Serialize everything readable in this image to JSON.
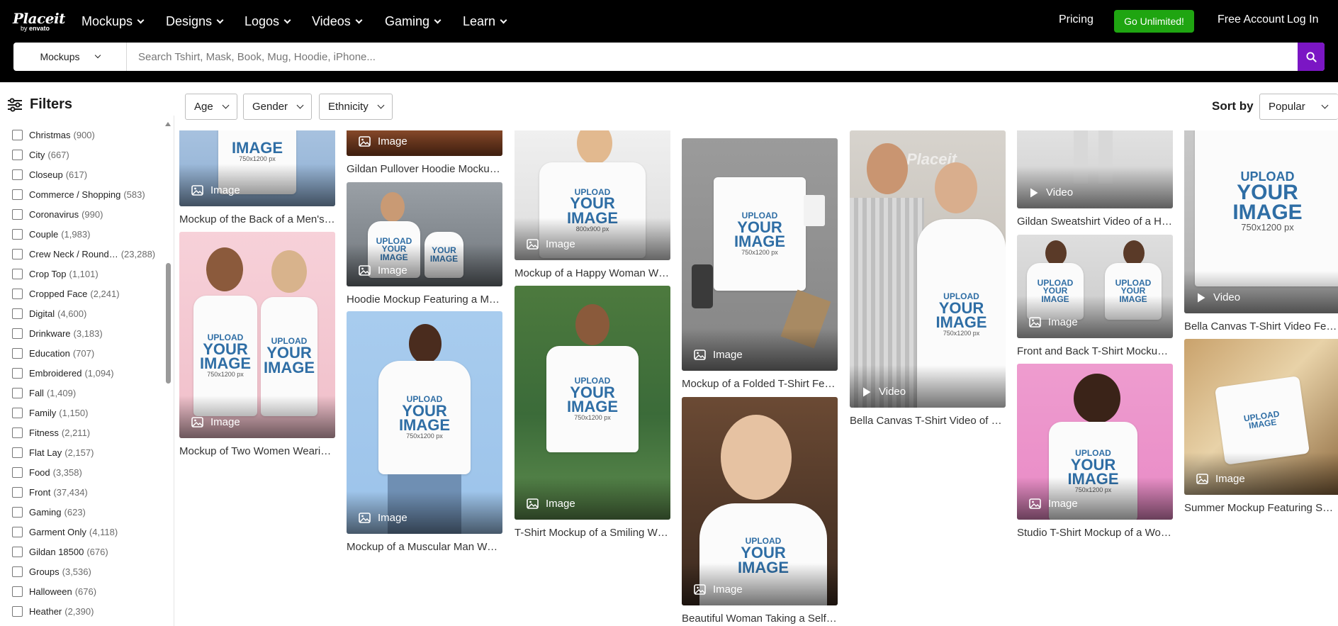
{
  "header": {
    "logo_main": "Placeit",
    "logo_by": "by",
    "logo_brand": "envato",
    "nav": [
      {
        "label": "Mockups"
      },
      {
        "label": "Designs"
      },
      {
        "label": "Logos"
      },
      {
        "label": "Videos"
      },
      {
        "label": "Gaming"
      },
      {
        "label": "Learn"
      }
    ],
    "pricing": "Pricing",
    "cta": "Go Unlimited!",
    "free_account": "Free Account",
    "login": "Log In",
    "search_category": "Mockups",
    "search_placeholder": "Search Tshirt, Mask, Book, Mug, Hoodie, iPhone...",
    "cta_color": "#1fa511",
    "search_button_color": "#7b16c4"
  },
  "filters": {
    "title": "Filters",
    "items": [
      {
        "label": "Christmas",
        "count": "(900)"
      },
      {
        "label": "City",
        "count": "(667)"
      },
      {
        "label": "Closeup",
        "count": "(617)"
      },
      {
        "label": "Commerce / Shopping",
        "count": "(583)"
      },
      {
        "label": "Coronavirus",
        "count": "(990)"
      },
      {
        "label": "Couple",
        "count": "(1,983)"
      },
      {
        "label": "Crew Neck / Round…",
        "count": "(23,288)"
      },
      {
        "label": "Crop Top",
        "count": "(1,101)"
      },
      {
        "label": "Cropped Face",
        "count": "(2,241)"
      },
      {
        "label": "Digital",
        "count": "(4,600)"
      },
      {
        "label": "Drinkware",
        "count": "(3,183)"
      },
      {
        "label": "Education",
        "count": "(707)"
      },
      {
        "label": "Embroidered",
        "count": "(1,094)"
      },
      {
        "label": "Fall",
        "count": "(1,409)"
      },
      {
        "label": "Family",
        "count": "(1,150)"
      },
      {
        "label": "Fitness",
        "count": "(2,211)"
      },
      {
        "label": "Flat Lay",
        "count": "(2,157)"
      },
      {
        "label": "Food",
        "count": "(3,358)"
      },
      {
        "label": "Front",
        "count": "(37,434)"
      },
      {
        "label": "Gaming",
        "count": "(623)"
      },
      {
        "label": "Garment Only",
        "count": "(4,118)"
      },
      {
        "label": "Gildan 18500",
        "count": "(676)"
      },
      {
        "label": "Groups",
        "count": "(3,536)"
      },
      {
        "label": "Halloween",
        "count": "(676)"
      },
      {
        "label": "Heather",
        "count": "(2,390)"
      }
    ]
  },
  "toolbar": {
    "dropdowns": [
      {
        "label": "Age"
      },
      {
        "label": "Gender"
      },
      {
        "label": "Ethnicity"
      }
    ],
    "sort_label": "Sort by",
    "sort_value": "Popular"
  },
  "shirt_text": {
    "line1": "UPLOAD",
    "line2": "YOUR",
    "line3": "IMAGE",
    "size_a": "750x1200 px",
    "size_b": "800x900 px"
  },
  "watermark": "Placeit",
  "cards": [
    {
      "badge": "Image",
      "title": "Mockup of the Back of a Men's …"
    },
    {
      "badge": "Image",
      "title": "Mockup of Two Women Wearin…"
    },
    {
      "badge": "Image",
      "title": "Gildan Pullover Hoodie Mocku…"
    },
    {
      "badge": "Image",
      "title": "Hoodie Mockup Featuring a M…"
    },
    {
      "badge": "Image",
      "title": "Mockup of a Muscular Man We…"
    },
    {
      "badge": "Image",
      "title": "Mockup of a Happy Woman W…"
    },
    {
      "badge": "Image",
      "title": "T-Shirt Mockup of a Smiling W…"
    },
    {
      "badge": "Image",
      "title": "Mockup of a Folded T-Shirt Fea…"
    },
    {
      "badge": "Image",
      "title": "Beautiful Woman Taking a Self…"
    },
    {
      "badge": "Video",
      "title": "Bella Canvas T-Shirt Video of a …"
    },
    {
      "badge": "Video",
      "title": "Gildan Sweatshirt Video of a H…"
    },
    {
      "badge": "Image",
      "title": "Front and Back T-Shirt Mockup…"
    },
    {
      "badge": "Image",
      "title": "Studio T-Shirt Mockup of a Wo…"
    },
    {
      "badge": "Video",
      "title": "Bella Canvas T-Shirt Video Feat…"
    },
    {
      "badge": "Image",
      "title": "Summer Mockup Featuring Sw…"
    }
  ]
}
